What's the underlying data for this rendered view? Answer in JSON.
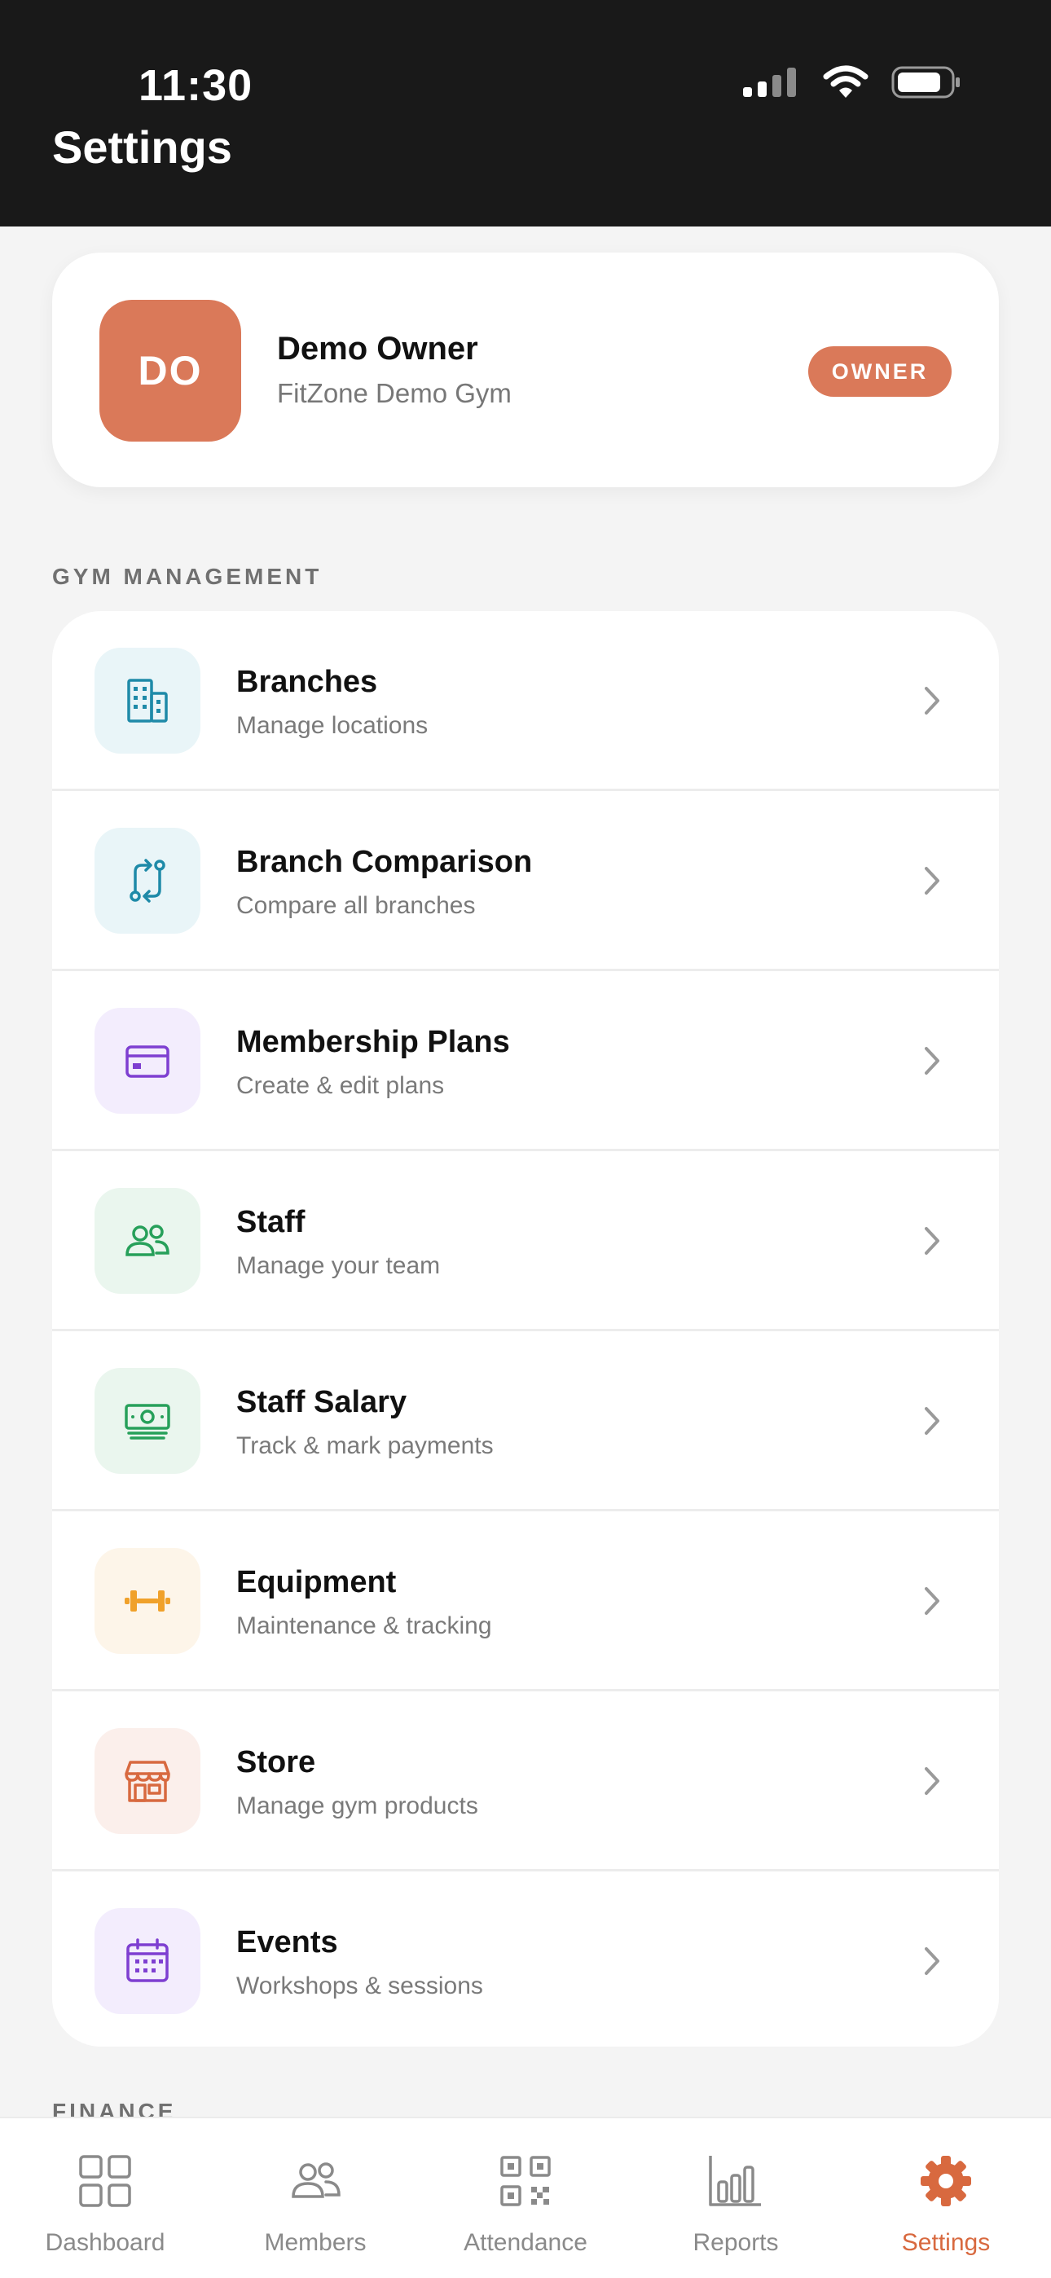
{
  "status_bar": {
    "time": "11:30"
  },
  "header": {
    "title": "Settings"
  },
  "profile": {
    "initials": "DO",
    "name": "Demo Owner",
    "gym": "FitZone Demo Gym",
    "role_badge": "OWNER"
  },
  "sections": {
    "gym_management": "GYM MANAGEMENT",
    "finance": "FINANCE"
  },
  "menu": [
    {
      "title": "Branches",
      "subtitle": "Manage locations",
      "icon": "building-icon",
      "color": "#1e8aa8",
      "bg": "#e9f5f8"
    },
    {
      "title": "Branch Comparison",
      "subtitle": "Compare all branches",
      "icon": "compare-arrows-icon",
      "color": "#1e8aa8",
      "bg": "#e9f5f8"
    },
    {
      "title": "Membership Plans",
      "subtitle": "Create & edit plans",
      "icon": "credit-card-icon",
      "color": "#7e3fd1",
      "bg": "#f3edfd"
    },
    {
      "title": "Staff",
      "subtitle": "Manage your team",
      "icon": "users-icon",
      "color": "#27a05a",
      "bg": "#eaf6ee"
    },
    {
      "title": "Staff Salary",
      "subtitle": "Track & mark payments",
      "icon": "cash-icon",
      "color": "#27a05a",
      "bg": "#eaf6ee"
    },
    {
      "title": "Equipment",
      "subtitle": "Maintenance & tracking",
      "icon": "dumbbell-icon",
      "color": "#f0a12a",
      "bg": "#fdf5e9"
    },
    {
      "title": "Store",
      "subtitle": "Manage gym products",
      "icon": "store-icon",
      "color": "#d8693f",
      "bg": "#fbefeb"
    },
    {
      "title": "Events",
      "subtitle": "Workshops & sessions",
      "icon": "calendar-icon",
      "color": "#7e3fd1",
      "bg": "#f3edfd"
    }
  ],
  "tabs": [
    {
      "label": "Dashboard",
      "icon": "grid-icon",
      "active": false
    },
    {
      "label": "Members",
      "icon": "users-icon",
      "active": false
    },
    {
      "label": "Attendance",
      "icon": "qr-code-icon",
      "active": false
    },
    {
      "label": "Reports",
      "icon": "bar-chart-icon",
      "active": false
    },
    {
      "label": "Settings",
      "icon": "gear-icon",
      "active": true
    }
  ],
  "colors": {
    "accent": "#d8693f",
    "header_bg": "#191919"
  }
}
